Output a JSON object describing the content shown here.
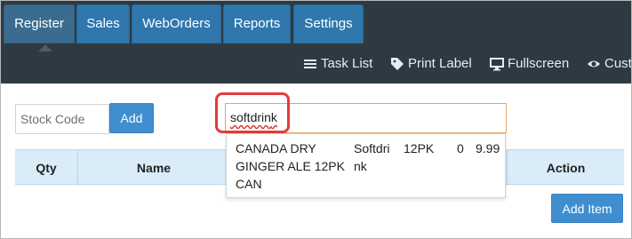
{
  "nav": {
    "tabs": [
      {
        "label": "Register",
        "active": true
      },
      {
        "label": "Sales",
        "active": false
      },
      {
        "label": "WebOrders",
        "active": false
      },
      {
        "label": "Reports",
        "active": false
      },
      {
        "label": "Settings",
        "active": false
      }
    ]
  },
  "toolbar": {
    "items": [
      {
        "label": "Task List",
        "icon": "list-icon"
      },
      {
        "label": "Print Label",
        "icon": "tag-icon"
      },
      {
        "label": "Fullscreen",
        "icon": "monitor-icon"
      },
      {
        "label": "Cust",
        "icon": "eye-icon"
      }
    ]
  },
  "stock": {
    "placeholder": "Stock Code",
    "add_label": "Add"
  },
  "search": {
    "value_prefix": "softdrin",
    "value_suffix": "k"
  },
  "grid": {
    "headers": [
      "Qty",
      "Name",
      "Action"
    ]
  },
  "dropdown": {
    "result": {
      "name": "CANADA DRY\nGINGER ALE 12PK\nCAN",
      "category": "Softdri\nnk",
      "size": "12PK",
      "qty": "0",
      "price": "9.99"
    }
  },
  "actions": {
    "add_item_label": "Add Item"
  },
  "colors": {
    "topbar": "#2d3a42",
    "tab_blue": "#2f77ad",
    "active_tab": "#3b6c8f",
    "primary_button": "#3f8fd0",
    "grid_header": "#d9ecf8",
    "search_border": "#e7a461",
    "highlight": "#e23b3b"
  }
}
